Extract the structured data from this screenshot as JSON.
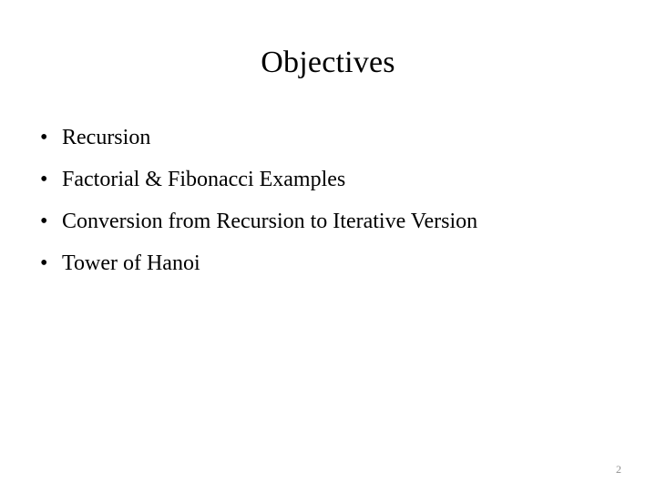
{
  "slide": {
    "title": "Objectives",
    "bullet_marker": "•",
    "bullets": [
      {
        "text": "Recursion",
        "justified": false
      },
      {
        "text": "Factorial & Fibonacci Examples",
        "justified": false
      },
      {
        "text": "Conversion from Recursion to Iterative Version",
        "justified": true
      },
      {
        "text": "Tower of Hanoi",
        "justified": false
      }
    ],
    "page_number": "2",
    "colors": {
      "background": "#ffffff",
      "text": "#000000",
      "page_number": "#8f8f8f"
    }
  }
}
